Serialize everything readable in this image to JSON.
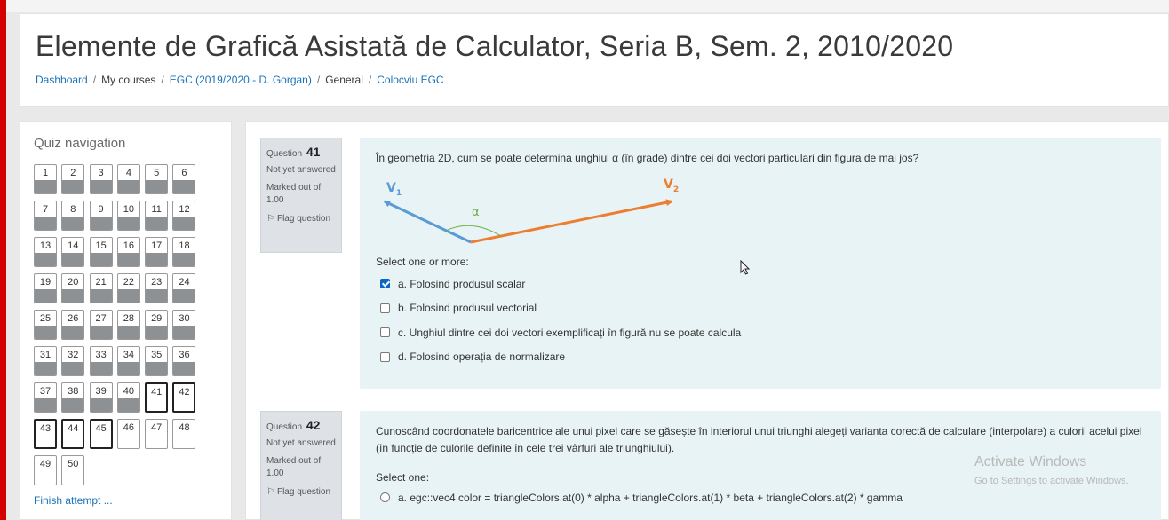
{
  "page_title": "Elemente de Grafică Asistată de Calculator, Seria B, Sem. 2, 2010/2020",
  "breadcrumb": {
    "items": [
      {
        "label": "Dashboard",
        "link": true
      },
      {
        "label": "My courses",
        "link": false
      },
      {
        "label": "EGC (2019/2020 - D. Gorgan)",
        "link": true
      },
      {
        "label": "General",
        "link": false
      },
      {
        "label": "Colocviu EGC",
        "link": true
      }
    ],
    "separator": "/"
  },
  "quiz_nav": {
    "title": "Quiz navigation",
    "buttons": [
      "1",
      "2",
      "3",
      "4",
      "5",
      "6",
      "7",
      "8",
      "9",
      "10",
      "11",
      "12",
      "13",
      "14",
      "15",
      "16",
      "17",
      "18",
      "19",
      "20",
      "21",
      "22",
      "23",
      "24",
      "25",
      "26",
      "27",
      "28",
      "29",
      "30",
      "31",
      "32",
      "33",
      "34",
      "35",
      "36",
      "37",
      "38",
      "39",
      "40",
      "41",
      "42",
      "43",
      "44",
      "45",
      "46",
      "47",
      "48",
      "49",
      "50"
    ],
    "current": [
      "41",
      "42",
      "43",
      "44",
      "45"
    ],
    "finish_label": "Finish attempt ..."
  },
  "questions": [
    {
      "number_prefix": "Question",
      "number": "41",
      "state": "Not yet answered",
      "marks": "Marked out of 1.00",
      "flag_label": "Flag question",
      "text": "În geometria 2D, cum se poate determina unghiul α (în grade) dintre cei doi vectori particulari din figura de mai jos?",
      "figure": {
        "v1_label": "V",
        "v1_sub": "1",
        "v2_label": "V",
        "v2_sub": "2",
        "angle_label": "α",
        "v1_color": "#5b9bd5",
        "v2_color": "#ed7d31",
        "angle_color": "#70ad47"
      },
      "prompt": "Select one or more:",
      "options": [
        {
          "label": "a. Folosind produsul scalar",
          "checked": true
        },
        {
          "label": "b. Folosind produsul vectorial",
          "checked": false
        },
        {
          "label": "c. Unghiul dintre cei doi vectori exemplificați în figură nu se poate calcula",
          "checked": false
        },
        {
          "label": "d. Folosind operația de normalizare",
          "checked": false
        }
      ]
    },
    {
      "number_prefix": "Question",
      "number": "42",
      "state": "Not yet answered",
      "marks": "Marked out of 1.00",
      "flag_label": "Flag question",
      "text": "Cunoscând coordonatele baricentrice ale unui pixel care se găsește în interiorul unui triunghi alegeți varianta corectă de calculare (interpolare) a culorii acelui pixel (în funcție de culorile definite în cele trei vârfuri ale triunghiului).",
      "prompt": "Select one:",
      "options": [
        {
          "label": "a. egc::vec4 color = triangleColors.at(0) * alpha + triangleColors.at(1) * beta + triangleColors.at(2) * gamma",
          "checked": false
        }
      ]
    }
  ],
  "watermark": {
    "title": "Activate Windows",
    "subtitle": "Go to Settings to activate Windows."
  },
  "colors": {
    "link": "#1a73ba",
    "question_bg": "#e7f3f5",
    "info_bg": "#dee2e6",
    "page_bg": "#e9e9e9",
    "accent_left": "#d50000"
  }
}
